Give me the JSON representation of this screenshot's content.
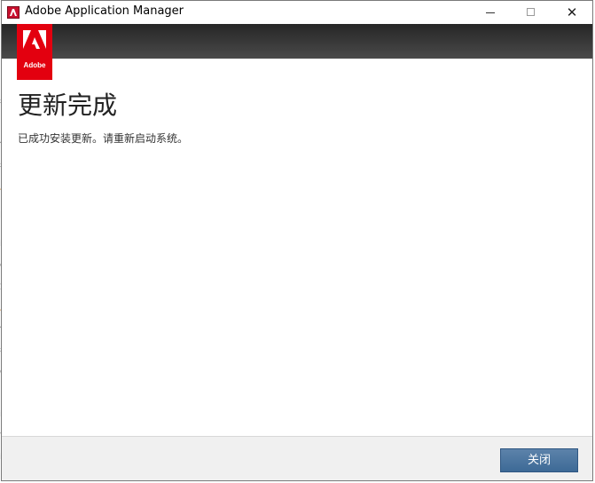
{
  "window": {
    "title": "Adobe Application Manager",
    "icon": "adobe-app-icon",
    "controls": {
      "minimize": "minimize-icon",
      "maximize": "maximize-icon",
      "close": "close-icon"
    }
  },
  "banner": {
    "logo_text": "Adobe",
    "brand_color": "#e3000f",
    "background_color": "#333333"
  },
  "content": {
    "heading": "更新完成",
    "message": "已成功安装更新。请重新启动系统。"
  },
  "footer": {
    "close_button_label": "关闭",
    "button_color": "#4a76a1"
  }
}
